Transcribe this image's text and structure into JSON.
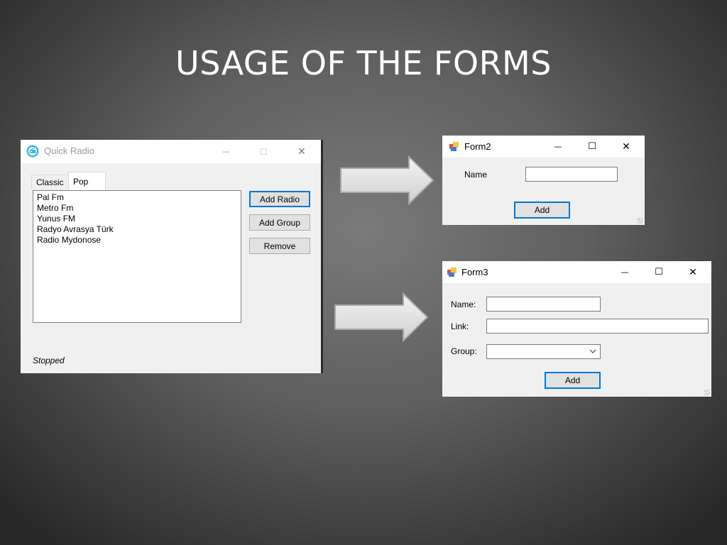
{
  "slide": {
    "title": "USAGE OF THE FORMS"
  },
  "quick_radio": {
    "title": "Quick Radio",
    "icon": "radio-app-icon",
    "tabs": [
      {
        "label": "Classic"
      },
      {
        "label": "Pop",
        "selected": true
      }
    ],
    "stations": [
      "Pal Fm",
      "Metro Fm",
      "Yunus FM",
      "Radyo Avrasya Türk",
      "Radio Mydonose"
    ],
    "buttons": {
      "add_radio": "Add Radio",
      "add_group": "Add Group",
      "remove": "Remove"
    },
    "status": "Stopped",
    "controls": {
      "minimize": "—",
      "maximize": "☐",
      "close": "✕"
    }
  },
  "form2": {
    "title": "Form2",
    "name_label": "Name",
    "name_value": "",
    "add_button": "Add",
    "controls": {
      "minimize": "—",
      "maximize": "☐",
      "close": "✕"
    }
  },
  "form3": {
    "title": "Form3",
    "name_label": "Name:",
    "link_label": "Link:",
    "group_label": "Group:",
    "name_value": "",
    "link_value": "",
    "group_value": "",
    "add_button": "Add",
    "controls": {
      "minimize": "—",
      "maximize": "☐",
      "close": "✕"
    }
  },
  "colors": {
    "accent": "#0078d7",
    "button_face": "#e1e1e1",
    "window_bg": "#f0f0f0"
  }
}
